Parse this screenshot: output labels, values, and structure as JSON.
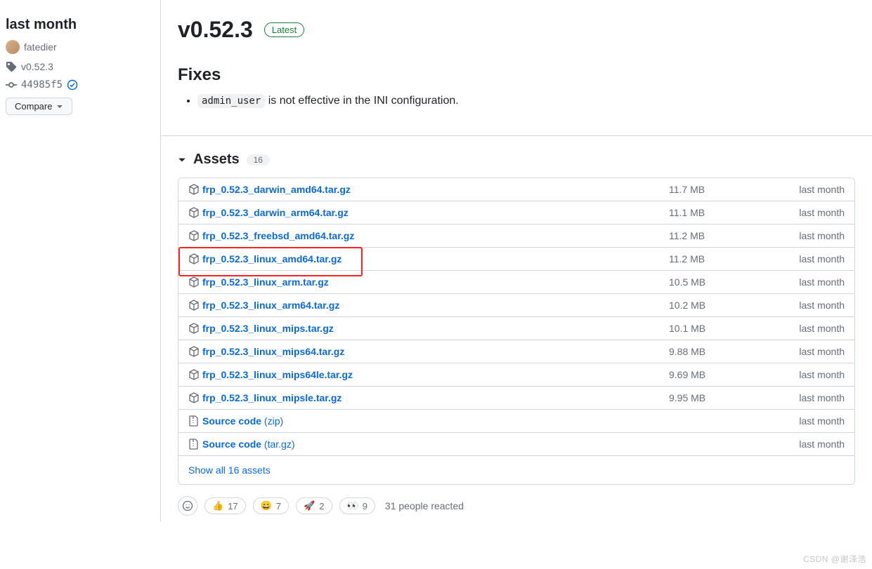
{
  "sidebar": {
    "time_label": "last month",
    "author": "fatedier",
    "tag": "v0.52.3",
    "commit": "44985f5",
    "compare_label": "Compare"
  },
  "release": {
    "title": "v0.52.3",
    "latest_label": "Latest",
    "fixes_heading": "Fixes",
    "fix_code": "admin_user",
    "fix_text_rest": " is not effective in the INI configuration."
  },
  "assets": {
    "heading": "Assets",
    "count": "16",
    "show_all": "Show all 16 assets",
    "items": [
      {
        "name": "frp_0.52.3_darwin_amd64.tar.gz",
        "size": "11.7 MB",
        "date": "last month",
        "type": "pkg",
        "highlight": false
      },
      {
        "name": "frp_0.52.3_darwin_arm64.tar.gz",
        "size": "11.1 MB",
        "date": "last month",
        "type": "pkg",
        "highlight": false
      },
      {
        "name": "frp_0.52.3_freebsd_amd64.tar.gz",
        "size": "11.2 MB",
        "date": "last month",
        "type": "pkg",
        "highlight": false
      },
      {
        "name": "frp_0.52.3_linux_amd64.tar.gz",
        "size": "11.2 MB",
        "date": "last month",
        "type": "pkg",
        "highlight": true
      },
      {
        "name": "frp_0.52.3_linux_arm.tar.gz",
        "size": "10.5 MB",
        "date": "last month",
        "type": "pkg",
        "highlight": false
      },
      {
        "name": "frp_0.52.3_linux_arm64.tar.gz",
        "size": "10.2 MB",
        "date": "last month",
        "type": "pkg",
        "highlight": false
      },
      {
        "name": "frp_0.52.3_linux_mips.tar.gz",
        "size": "10.1 MB",
        "date": "last month",
        "type": "pkg",
        "highlight": false
      },
      {
        "name": "frp_0.52.3_linux_mips64.tar.gz",
        "size": "9.88 MB",
        "date": "last month",
        "type": "pkg",
        "highlight": false
      },
      {
        "name": "frp_0.52.3_linux_mips64le.tar.gz",
        "size": "9.69 MB",
        "date": "last month",
        "type": "pkg",
        "highlight": false
      },
      {
        "name": "frp_0.52.3_linux_mipsle.tar.gz",
        "size": "9.95 MB",
        "date": "last month",
        "type": "pkg",
        "highlight": false
      },
      {
        "name": "Source code",
        "suffix": " (zip)",
        "size": "",
        "date": "last month",
        "type": "zip",
        "highlight": false
      },
      {
        "name": "Source code",
        "suffix": " (tar.gz)",
        "size": "",
        "date": "last month",
        "type": "zip",
        "highlight": false
      }
    ]
  },
  "reactions": {
    "thumbs_up": "17",
    "laugh": "7",
    "rocket": "2",
    "eyes": "9",
    "summary": "31 people reacted"
  },
  "watermark": "CSDN @谢泽浩"
}
